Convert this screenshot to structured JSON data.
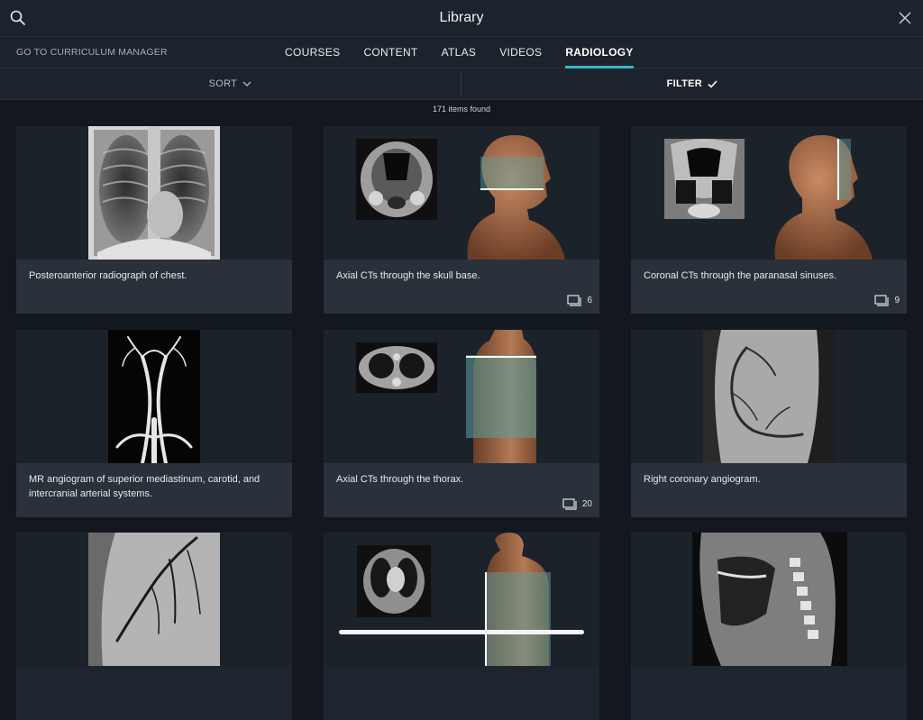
{
  "header": {
    "title": "Library",
    "search_icon": "search-icon",
    "close_icon": "close-icon"
  },
  "nav": {
    "curriculum_link": "GO TO CURRICULUM MANAGER",
    "tabs": [
      {
        "label": "COURSES",
        "active": false
      },
      {
        "label": "CONTENT",
        "active": false
      },
      {
        "label": "ATLAS",
        "active": false
      },
      {
        "label": "VIDEOS",
        "active": false
      },
      {
        "label": "RADIOLOGY",
        "active": true
      }
    ]
  },
  "toolbar": {
    "sort_label": "SORT",
    "filter_label": "FILTER"
  },
  "results": {
    "count_text": "171 items found"
  },
  "cards": [
    {
      "caption": "Posteroanterior radiograph of chest.",
      "count": ""
    },
    {
      "caption": "Axial CTs through the skull base.",
      "count": "6"
    },
    {
      "caption": "Coronal CTs through the paranasal sinuses.",
      "count": "9"
    },
    {
      "caption": "MR angiogram of superior mediastinum, carotid, and intercranial arterial systems.",
      "count": ""
    },
    {
      "caption": "Axial CTs through the thorax.",
      "count": "20"
    },
    {
      "caption": "Right coronary angiogram.",
      "count": ""
    }
  ],
  "colors": {
    "accent": "#39b9c4",
    "background": "#121720",
    "bar": "#1d232c",
    "caption_bg": "#2b313a"
  }
}
